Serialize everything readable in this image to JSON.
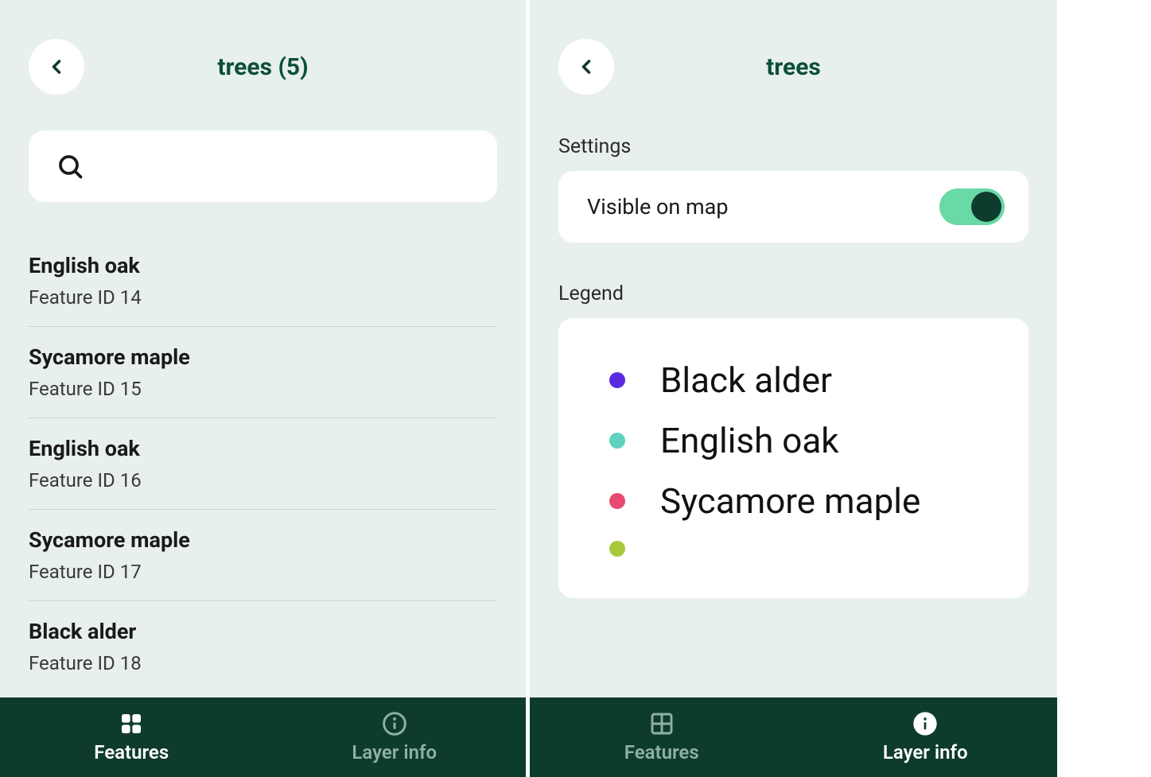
{
  "left": {
    "title": "trees (5)",
    "search_placeholder": "",
    "features": [
      {
        "name": "English oak",
        "sub": "Feature ID 14"
      },
      {
        "name": "Sycamore maple",
        "sub": "Feature ID 15"
      },
      {
        "name": "English oak",
        "sub": "Feature ID 16"
      },
      {
        "name": "Sycamore maple",
        "sub": "Feature ID 17"
      },
      {
        "name": "Black alder",
        "sub": "Feature ID 18"
      }
    ],
    "nav": {
      "features": "Features",
      "layer_info": "Layer info"
    }
  },
  "right": {
    "title": "trees",
    "settings_label": "Settings",
    "visible_label": "Visible on map",
    "visible_on": true,
    "legend_label": "Legend",
    "legend": [
      {
        "color": "#5b2be0",
        "label": "Black alder"
      },
      {
        "color": "#5fd1bd",
        "label": "English oak"
      },
      {
        "color": "#e84a6f",
        "label": "Sycamore maple"
      },
      {
        "color": "#a8c83c",
        "label": ""
      }
    ],
    "nav": {
      "features": "Features",
      "layer_info": "Layer info"
    }
  }
}
